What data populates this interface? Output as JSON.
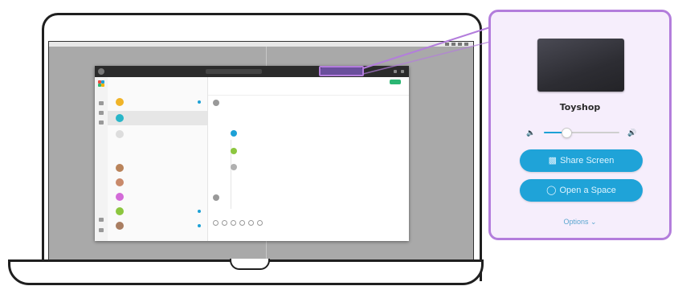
{
  "panel": {
    "device_name": "Toyshop",
    "volume_level": 0.3,
    "share_screen_label": "Share Screen",
    "open_space_label": "Open a Space",
    "options_label": "Options",
    "share_icon": "screen-share-icon",
    "space_icon": "space-icon",
    "accent_color": "#1fa3d8",
    "callout_color": "#b37ddc"
  },
  "colors": {
    "panel_bg": "#f6eefc",
    "button_bg": "#1fa3d8"
  }
}
